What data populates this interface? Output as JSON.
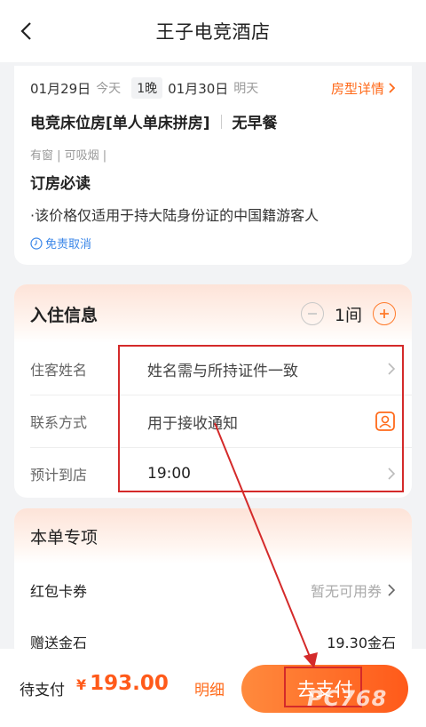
{
  "header": {
    "title": "王子电竞酒店",
    "back_icon": "chevron-left-icon"
  },
  "booking": {
    "checkin_date": "01月29日",
    "checkin_day": "今天",
    "nights": "1晚",
    "checkout_date": "01月30日",
    "checkout_day": "明天",
    "room_detail_link": "房型详情",
    "room_name": "电竞床位房[单人单床拼房]",
    "breakfast": "无早餐",
    "tags": "有窗 | 可吸烟 |",
    "must_read_title": "订房必读",
    "must_read_note": "·该价格仅适用于持大陆身份证的中国籍游客人",
    "free_cancel": "免责取消"
  },
  "checkin_info": {
    "title": "入住信息",
    "room_count": "1间",
    "guest_name_label": "住客姓名",
    "guest_name_placeholder": "姓名需与所持证件一致",
    "contact_label": "联系方式",
    "contact_placeholder": "用于接收通知",
    "arrival_label": "预计到店",
    "arrival_value": "19:00"
  },
  "specials": {
    "title": "本单专项",
    "coupon_label": "红包卡券",
    "coupon_value": "暂无可用券",
    "gift_label": "赠送金石",
    "gift_value": "19.30金石"
  },
  "footer": {
    "pay_label": "待支付",
    "currency": "¥",
    "amount": "193.00",
    "detail_label": "明细",
    "pay_button": "去支付"
  },
  "watermark": "PC768",
  "colors": {
    "accent": "#ff6a1a",
    "annotation_red": "#d42a2a",
    "link_blue": "#3a86e8"
  }
}
